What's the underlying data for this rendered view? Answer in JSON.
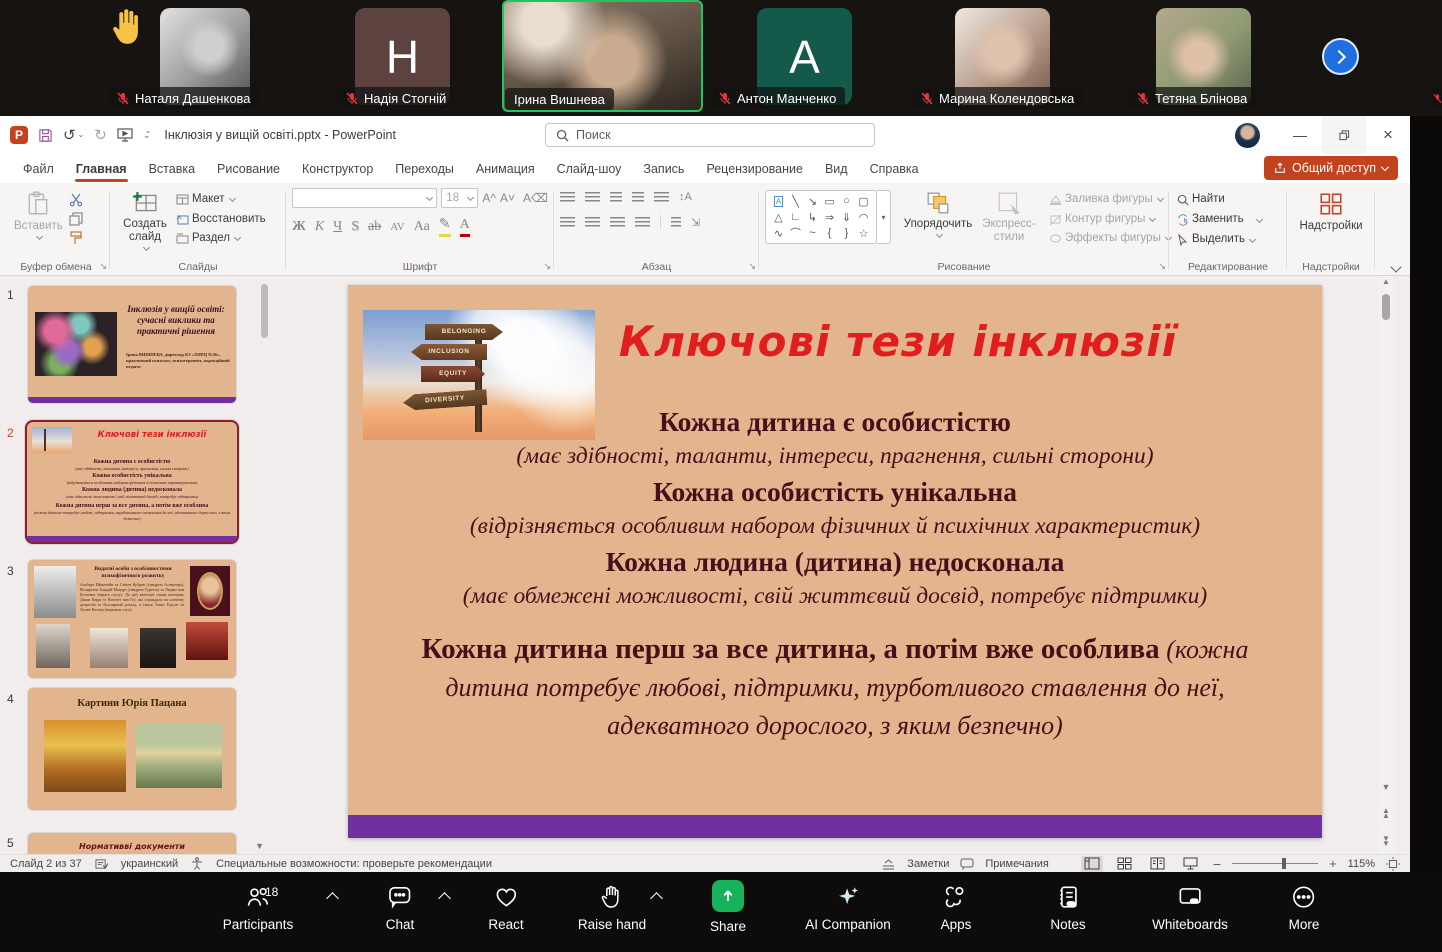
{
  "meeting": {
    "participants": [
      {
        "name": "Наталя Дашенкова",
        "muted": true,
        "avatar": "photo",
        "raised_hand": true
      },
      {
        "name": "Надія Стогній",
        "muted": true,
        "avatar": "letter",
        "letter": "H"
      },
      {
        "name": "Ірина Вишнева",
        "muted": false,
        "avatar": "video",
        "active_speaker": true
      },
      {
        "name": "Антон Манченко",
        "muted": true,
        "avatar": "letter",
        "letter": "A"
      },
      {
        "name": "Марина Колендовська",
        "muted": true,
        "avatar": "photo"
      },
      {
        "name": "Тетяна Блінова",
        "muted": true,
        "avatar": "photo"
      }
    ],
    "toolbar": {
      "participants_label": "Participants",
      "participants_count": "18",
      "chat_label": "Chat",
      "react_label": "React",
      "raise_hand_label": "Raise hand",
      "share_label": "Share",
      "ai_label": "AI Companion",
      "apps_label": "Apps",
      "notes_label": "Notes",
      "whiteboards_label": "Whiteboards",
      "more_label": "More"
    },
    "colors": {
      "share_green": "#17b35c",
      "active_speaker_border": "#21c45f",
      "next_button_blue": "#1f6fe0"
    }
  },
  "powerpoint": {
    "titlebar": {
      "document_title": "Інклюзія у вищій освіті.pptx  -  PowerPoint",
      "search_placeholder": "Поиск",
      "minimize": "—",
      "close": "×"
    },
    "share_button_label": "Общий доступ",
    "tabs": [
      {
        "label": "Файл"
      },
      {
        "label": "Главная",
        "active": true
      },
      {
        "label": "Вставка"
      },
      {
        "label": "Рисование"
      },
      {
        "label": "Конструктор"
      },
      {
        "label": "Переходы"
      },
      {
        "label": "Анимация"
      },
      {
        "label": "Слайд-шоу"
      },
      {
        "label": "Запись"
      },
      {
        "label": "Рецензирование"
      },
      {
        "label": "Вид"
      },
      {
        "label": "Справка"
      }
    ],
    "ribbon": {
      "clipboard": {
        "paste_label": "Вставить",
        "group_label": "Буфер обмена"
      },
      "slides": {
        "new_slide_label": "Создать слайд",
        "layout_label": "Макет",
        "reset_label": "Восстановить",
        "section_label": "Раздел",
        "group_label": "Слайды"
      },
      "font": {
        "size_value": "18",
        "group_label": "Шрифт",
        "buttons": {
          "bold": "Ж",
          "italic": "К",
          "underline": "Ч",
          "shadow": "S",
          "strike": "ab",
          "spacing": "AV",
          "case": "Аа",
          "color": "А",
          "grow": "А^",
          "shrink": "А˅",
          "clear": "А"
        }
      },
      "paragraph": {
        "group_label": "Абзац"
      },
      "drawing": {
        "arrange_label": "Упорядочить",
        "quick_styles_label": "Экспресс-стили",
        "fill_label": "Заливка фигуры",
        "outline_label": "Контур фигуры",
        "effects_label": "Эффекты фигуры",
        "group_label": "Рисование"
      },
      "editing": {
        "find_label": "Найти",
        "replace_label": "Заменить",
        "select_label": "Выделить",
        "group_label": "Редактирование"
      },
      "addins": {
        "button_label": "Надстройки",
        "group_label": "Надстройки"
      }
    },
    "status": {
      "slide_indicator": "Слайд 2 из 37",
      "language": "украинский",
      "accessibility": "Специальные возможности: проверьте рекомендации",
      "notes_label": "Заметки",
      "comments_label": "Примечания",
      "zoom_level": "115%"
    },
    "slides_panel": {
      "items": [
        {
          "number": "1",
          "title": "Інклюзія у вищій освіті: сучасні виклики та практичні рішення",
          "subtitle": "Ірина ВИШНЕВА, директор КЗ «ХНРЦ №56», практичний психолог, психотерапевт, корекційний педагог"
        },
        {
          "number": "2",
          "title": "Ключові тези інклюзії",
          "selected": true
        },
        {
          "number": "3",
          "title": "Видатні особи з особливостями психофізичного розвитку",
          "body": "Альберт Ейнштейн та Стівен Кубрик (синдром Аспергера), Вольфганг Амадей Моцарт (синдром Туретта) та Людвіг ван Бетховен (втрата слуху). До цієї категорії також належать Джим Керрі та Вінсент ван Гог, які страждали на клінічну депресію та біполярний розлад, а також Томас Едісон та Хелен Келлер (втратили слух)."
        },
        {
          "number": "4",
          "title": "Картини Юрія Пацана"
        },
        {
          "number": "5",
          "title": "Нормативві документи"
        }
      ]
    },
    "slide": {
      "title": "Ключові тези інклюзії",
      "signpost": [
        "BELONGING",
        "INCLUSION",
        "EQUITY",
        "DIVERSITY"
      ],
      "theses": [
        {
          "bold": "Кожна дитина є особистістю",
          "italic": "(має здібності, таланти, інтереси, прагнення, сильні сторони)"
        },
        {
          "bold": "Кожна особистість унікальна",
          "italic": "(відрізняється особливим набором фізичних й психічних характеристик)"
        },
        {
          "bold": "Кожна людина (дитина) недосконала",
          "italic": "(має обмежені можливості, свій життєвий досвід, потребує підтримки)"
        },
        {
          "bold": "Кожна дитина перш за все дитина, а потім вже особлива",
          "italic": "(кожна дитина потребує любові, підтримки, турботливого ставлення до неї, адекватного дорослого, з яким безпечно)"
        }
      ],
      "colors": {
        "background": "#e3b58e",
        "title": "#e01e1e",
        "text": "#451019",
        "accent_bar": "#7030a0"
      }
    }
  }
}
